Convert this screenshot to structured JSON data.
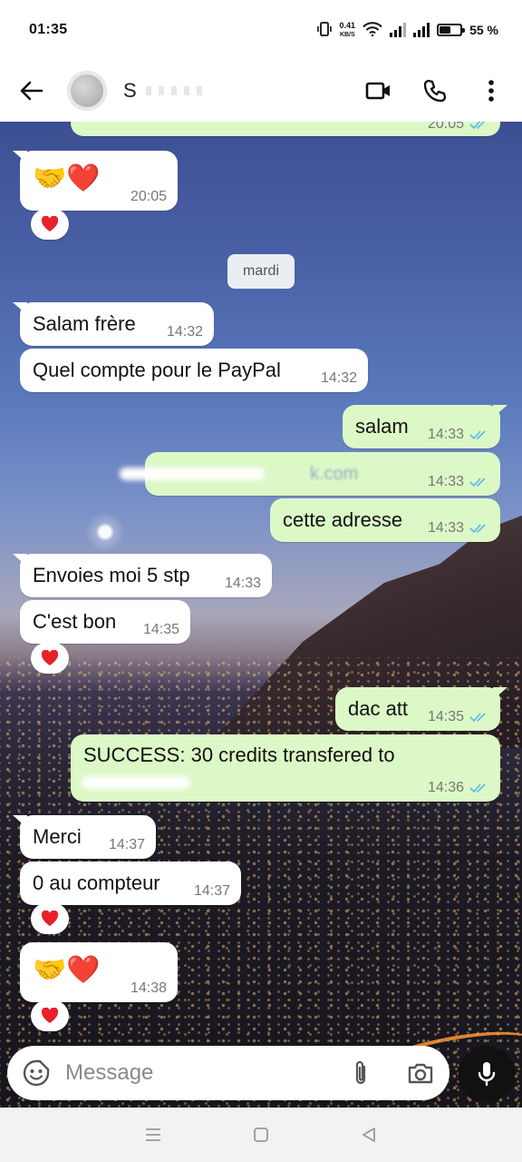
{
  "status_bar": {
    "time": "01:35",
    "net_speed_value": "0.41",
    "net_speed_unit": "KB/S",
    "battery": "55 %",
    "battery_level": 0.55
  },
  "header": {
    "contact_name": "S",
    "icons": [
      "back-arrow-icon",
      "video-call-icon",
      "phone-icon",
      "more-vertical-icon"
    ]
  },
  "chat": {
    "day_separator": "mardi",
    "messages": [
      {
        "dir": "out",
        "text": "",
        "time": "20:05",
        "ticks": "read"
      },
      {
        "dir": "in",
        "text": "🤝❤️",
        "time": "20:05",
        "reaction": "heart"
      },
      {
        "dir": "in",
        "text": "Salam frère",
        "time": "14:32"
      },
      {
        "dir": "in",
        "text": "Quel compte pour le PayPal",
        "time": "14:32"
      },
      {
        "dir": "out",
        "text": "salam",
        "time": "14:33",
        "ticks": "read"
      },
      {
        "dir": "out",
        "text": "k.com",
        "time": "14:33",
        "ticks": "read"
      },
      {
        "dir": "out",
        "text": "cette adresse",
        "time": "14:33",
        "ticks": "read"
      },
      {
        "dir": "in",
        "text": "Envoies moi 5 stp",
        "time": "14:33"
      },
      {
        "dir": "in",
        "text": "C'est bon",
        "time": "14:35",
        "reaction": "heart"
      },
      {
        "dir": "out",
        "text": "dac att",
        "time": "14:35",
        "ticks": "read"
      },
      {
        "dir": "out",
        "text": "SUCCESS: 30 credits transfered to",
        "time": "14:36",
        "ticks": "read"
      },
      {
        "dir": "in",
        "text": "Merci",
        "time": "14:37"
      },
      {
        "dir": "in",
        "text": "0 au compteur",
        "time": "14:37",
        "reaction": "heart"
      },
      {
        "dir": "in",
        "text": "🤝❤️",
        "time": "14:38",
        "reaction": "heart"
      }
    ]
  },
  "composer": {
    "placeholder": "Message",
    "icons": [
      "emoji-icon",
      "attach-icon",
      "camera-icon",
      "mic-icon"
    ]
  },
  "nav_bar": {
    "icons": [
      "menu-icon",
      "home-icon",
      "back-icon"
    ]
  },
  "colors": {
    "incoming_bubble": "#ffffff",
    "outgoing_bubble": "#dcf8c6",
    "tick_color": "#53bdeb"
  }
}
